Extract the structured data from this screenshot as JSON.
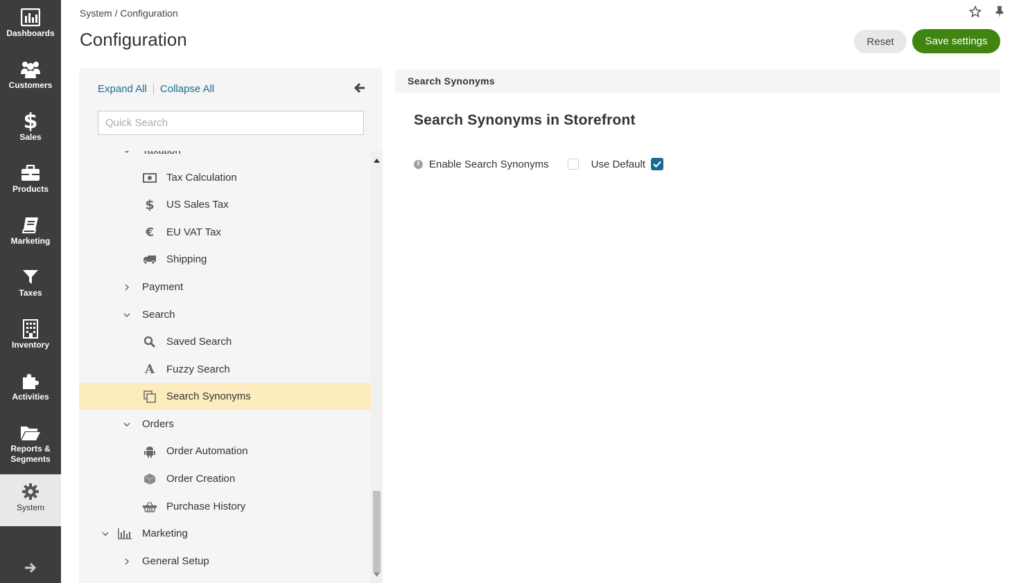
{
  "nav": {
    "items": [
      {
        "label": "Dashboards",
        "icon": "dashboards-icon"
      },
      {
        "label": "Customers",
        "icon": "customers-icon"
      },
      {
        "label": "Sales",
        "icon": "dollar-icon"
      },
      {
        "label": "Products",
        "icon": "briefcase-icon"
      },
      {
        "label": "Marketing",
        "icon": "book-icon"
      },
      {
        "label": "Taxes",
        "icon": "funnel-icon"
      },
      {
        "label": "Inventory",
        "icon": "building-icon"
      },
      {
        "label": "Activities",
        "icon": "puzzle-icon"
      },
      {
        "label": "Reports &\nSegments",
        "icon": "folder-icon"
      },
      {
        "label": "System",
        "icon": "gear-icon",
        "active": true
      }
    ]
  },
  "header": {
    "breadcrumb": "System / Configuration",
    "title": "Configuration",
    "reset_label": "Reset",
    "save_label": "Save settings"
  },
  "tree": {
    "expand_all": "Expand All",
    "collapse_all": "Collapse All",
    "search_placeholder": "Quick Search",
    "items": [
      {
        "label": "Taxation",
        "level": 1,
        "chevron": "down",
        "partial": true
      },
      {
        "label": "Tax Calculation",
        "level": 2,
        "icon": "money-icon"
      },
      {
        "label": "US Sales Tax",
        "level": 2,
        "icon": "dollar-icon"
      },
      {
        "label": "EU VAT Tax",
        "level": 2,
        "icon": "euro-icon"
      },
      {
        "label": "Shipping",
        "level": 2,
        "icon": "truck-icon"
      },
      {
        "label": "Payment",
        "level": 1,
        "chevron": "right"
      },
      {
        "label": "Search",
        "level": 1,
        "chevron": "down"
      },
      {
        "label": "Saved Search",
        "level": 2,
        "icon": "search-icon"
      },
      {
        "label": "Fuzzy Search",
        "level": 2,
        "icon": "font-icon"
      },
      {
        "label": "Search Synonyms",
        "level": 2,
        "icon": "copy-icon",
        "selected": true
      },
      {
        "label": "Orders",
        "level": 1,
        "chevron": "down"
      },
      {
        "label": "Order Automation",
        "level": 2,
        "icon": "android-icon"
      },
      {
        "label": "Order Creation",
        "level": 2,
        "icon": "cube-icon"
      },
      {
        "label": "Purchase History",
        "level": 2,
        "icon": "basket-icon"
      },
      {
        "label": "Marketing",
        "level": 0,
        "chevron": "down",
        "icon": "bar-chart-icon"
      },
      {
        "label": "General Setup",
        "level": 1,
        "chevron": "right"
      }
    ]
  },
  "content": {
    "section_header": "Search Synonyms",
    "section_title": "Search Synonyms in Storefront",
    "setting_label": "Enable Search Synonyms",
    "use_default_label": "Use Default",
    "enabled": false,
    "use_default": true
  },
  "colors": {
    "nav_bg": "#3d3d3d",
    "accent_link": "#1a6a93",
    "save_green": "#3f8510",
    "selected_row": "#fdecbe"
  }
}
